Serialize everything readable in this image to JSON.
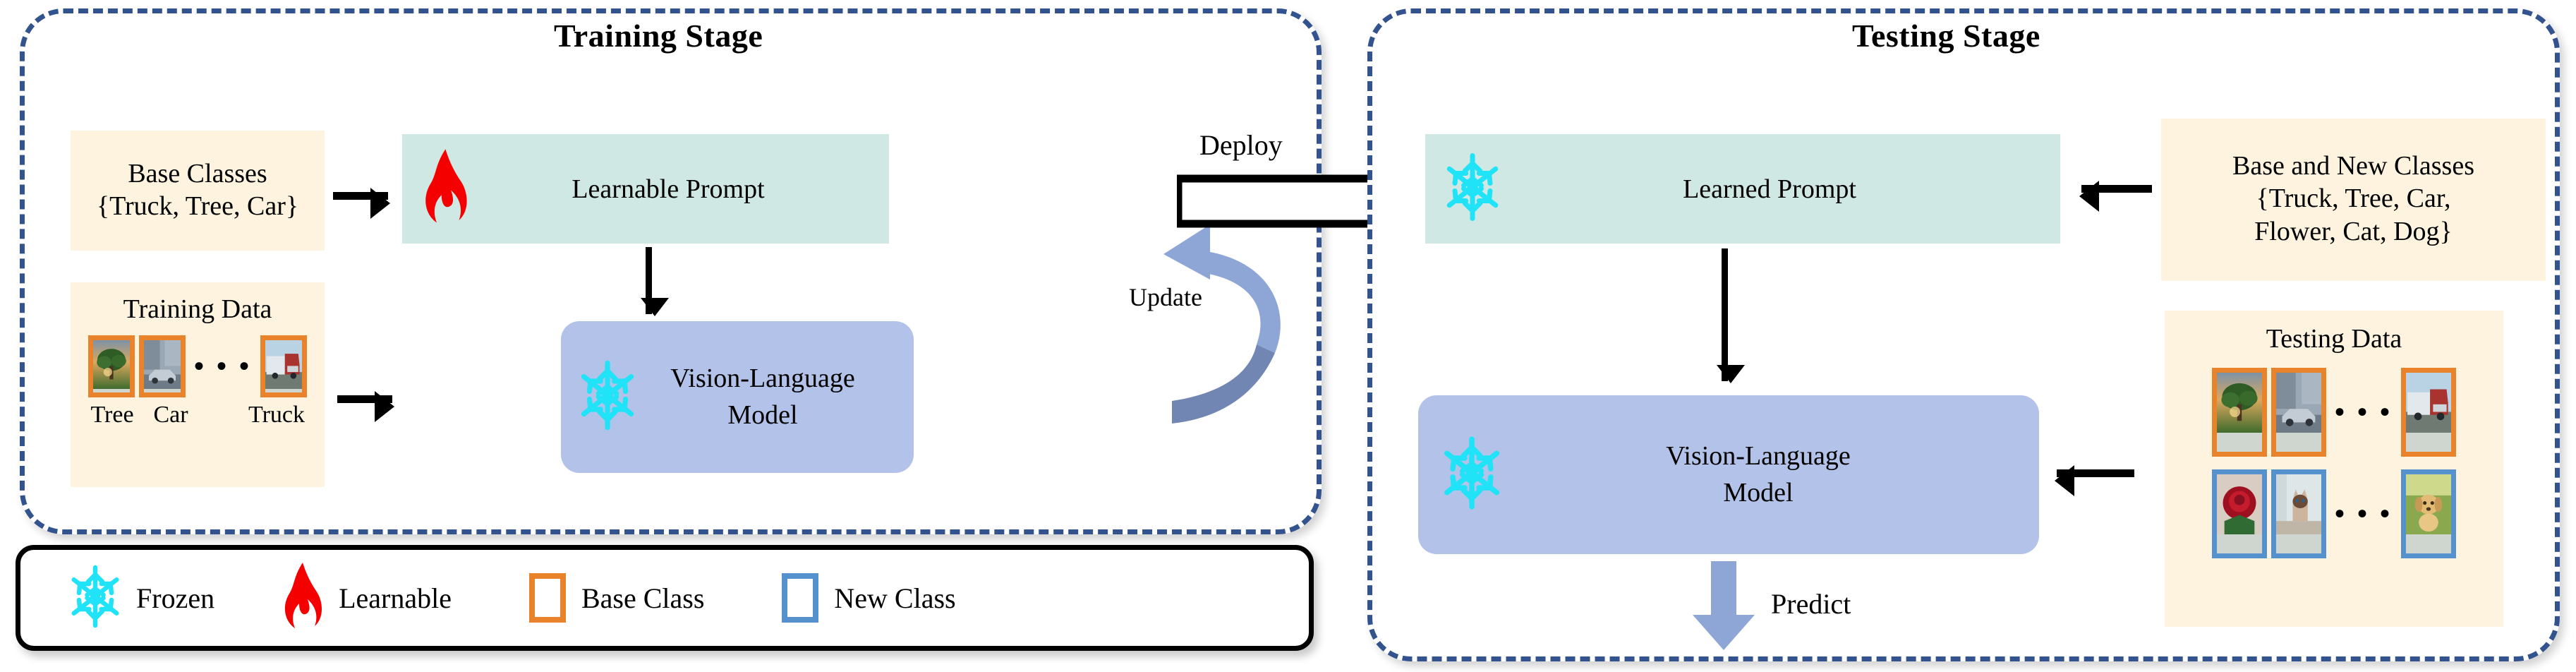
{
  "training": {
    "title": "Training Stage",
    "base_classes": {
      "title": "Base Classes",
      "list": "{Truck, Tree, Car}"
    },
    "training_data": {
      "title": "Training Data",
      "captions": [
        "Tree",
        "Car",
        "Truck"
      ],
      "ellipsis": "• • •",
      "thumbs": [
        "tree-thumbnail",
        "car-thumbnail",
        "truck-thumbnail"
      ]
    },
    "prompt_box": {
      "label": "Learnable  Prompt",
      "icon": "flame-icon"
    },
    "vlm_box": {
      "label": "Vision-Language\nModel",
      "line1": "Vision-Language",
      "line2": "Model",
      "icon": "snowflake-icon"
    },
    "update_label": "Update"
  },
  "deploy_label": "Deploy",
  "testing": {
    "title": "Testing Stage",
    "classes": {
      "title": "Base and New Classes",
      "line1": "{Truck, Tree, Car,",
      "line2": "Flower, Cat, Dog}"
    },
    "testing_data": {
      "title": "Testing Data",
      "ellipsis": "• • •",
      "row_base": [
        "tree-thumbnail",
        "car-thumbnail",
        "truck-thumbnail"
      ],
      "row_new": [
        "rose-thumbnail",
        "cat-thumbnail",
        "dog-thumbnail"
      ]
    },
    "prompt_box": {
      "label": "Learned  Prompt",
      "icon": "snowflake-icon"
    },
    "vlm_box": {
      "line1": "Vision-Language",
      "line2": "Model",
      "icon": "snowflake-icon"
    },
    "predict_label": "Predict"
  },
  "legend": {
    "items": [
      {
        "icon": "snowflake-icon",
        "label": "Frozen"
      },
      {
        "icon": "flame-icon",
        "label": "Learnable"
      },
      {
        "icon": "orange-square-icon",
        "label": "Base Class"
      },
      {
        "icon": "blue-square-icon",
        "label": "New Class"
      }
    ]
  },
  "colors": {
    "panel_border": "#33538f",
    "cream": "#fdf3df",
    "teal": "#cfe8e4",
    "vlm_blue": "#b3c2e8",
    "base_class": "#e8832b",
    "new_class": "#5591cd",
    "snowflake": "#21e3f7",
    "flame": "#f50000",
    "update_arrow": "#8ea6d6"
  }
}
